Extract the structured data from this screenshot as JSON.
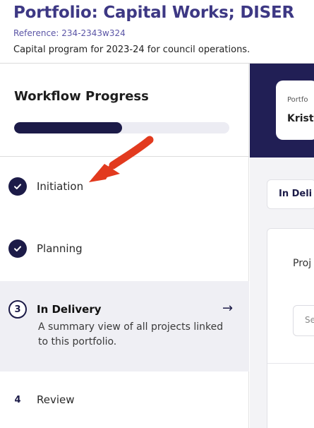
{
  "header": {
    "title": "Portfolio: Capital Works; DISER",
    "reference": "Reference: 234-2343w324",
    "description": "Capital program for 2023-24 for council operations."
  },
  "sidebar": {
    "title": "Workflow Progress",
    "progress_fraction": 0.5,
    "steps": [
      {
        "marker": "check",
        "label": "Initiation",
        "status": "complete"
      },
      {
        "marker": "check",
        "label": "Planning",
        "status": "complete"
      },
      {
        "marker": "3",
        "label": "In Delivery",
        "status": "current",
        "description": "A summary view of all projects linked to this portfolio."
      },
      {
        "marker": "4",
        "label": "Review",
        "status": "upcoming"
      }
    ]
  },
  "main": {
    "card_caption": "Portfo",
    "card_name": "Krist",
    "status_tab": "In Deli",
    "projects_label": "Proj",
    "search_placeholder": "Se"
  },
  "colors": {
    "brand": "#3d3884",
    "dark": "#1c1b48",
    "annotation_arrow": "#e23a1e"
  }
}
